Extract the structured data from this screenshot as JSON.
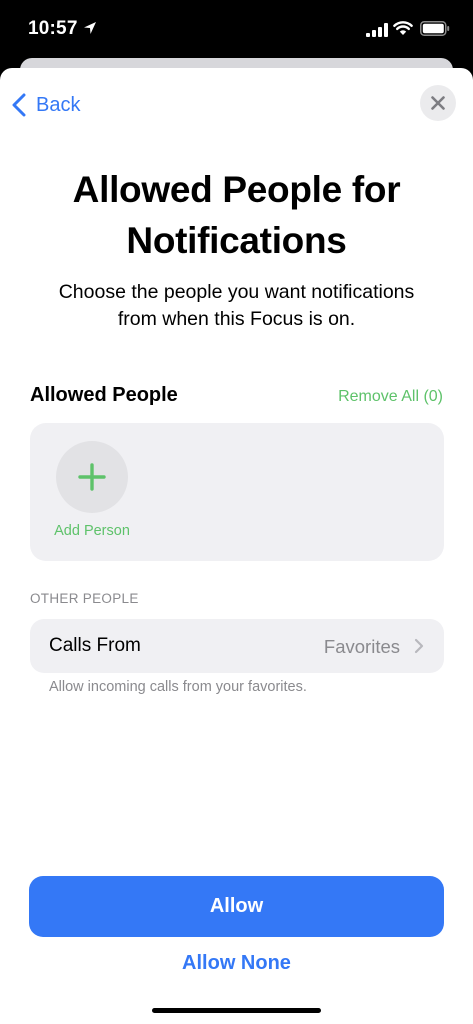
{
  "status_bar": {
    "time": "10:57",
    "icons": [
      "location-arrow-icon",
      "cellular-signal-icon",
      "wifi-icon",
      "battery-icon"
    ]
  },
  "nav": {
    "back_label": "Back",
    "back_icon": "chevron-left-icon",
    "close_icon": "close-icon"
  },
  "header": {
    "title": "Allowed People for Notifications",
    "subtitle": "Choose the people you want notifications from when this Focus is on."
  },
  "allowed_people": {
    "section_title": "Allowed People",
    "remove_all_label": "Remove All (0)",
    "add_person_label": "Add Person",
    "add_icon": "plus-icon"
  },
  "other_people": {
    "section_header": "OTHER PEOPLE",
    "calls_from_label": "Calls From",
    "calls_from_value": "Favorites",
    "footnote": "Allow incoming calls from your favorites."
  },
  "actions": {
    "allow_label": "Allow",
    "allow_none_label": "Allow None"
  },
  "colors": {
    "accent_blue": "#3478f6",
    "accent_green": "#5ec26a",
    "card_bg": "#f0f0f3",
    "secondary_text": "#8a8a8e"
  }
}
